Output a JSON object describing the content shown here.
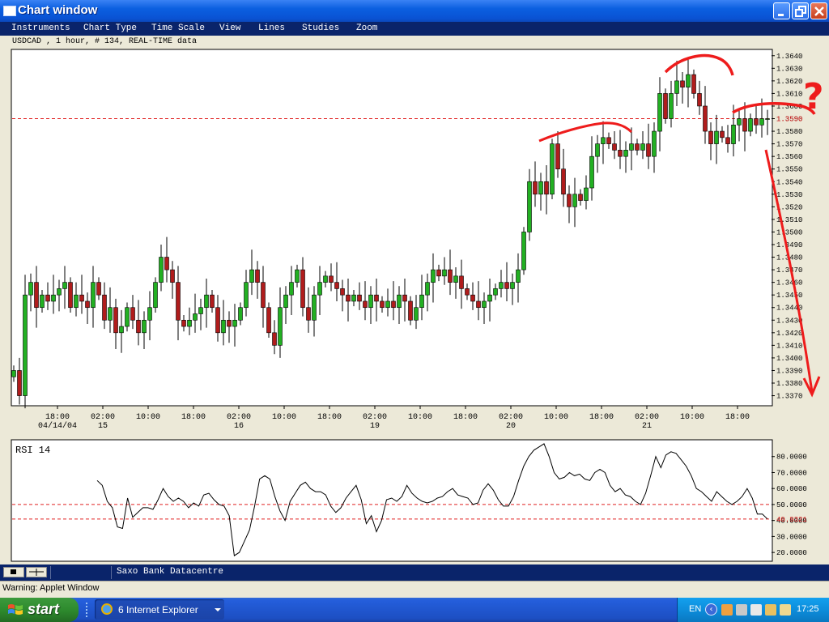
{
  "window": {
    "title": "Chart window",
    "buttons": [
      "minimize",
      "maximize",
      "close"
    ]
  },
  "menu": [
    "Instruments",
    "Chart Type",
    "Time Scale",
    "View",
    "Lines",
    "Studies",
    "Zoom"
  ],
  "info_line": "USDCAD , 1 hour, # 134, REAL-TIME data",
  "chart_data": [
    {
      "type": "candlestick",
      "title": "USDCAD , 1 hour, # 134, REAL-TIME data",
      "y_range": [
        1.3362,
        1.3645
      ],
      "y_ticks": [
        "1.3640",
        "1.3630",
        "1.3620",
        "1.3610",
        "1.3600",
        "1.3590",
        "1.3580",
        "1.3570",
        "1.3560",
        "1.3550",
        "1.3540",
        "1.3530",
        "1.3520",
        "1.3510",
        "1.3500",
        "1.3490",
        "1.3480",
        "1.3470",
        "1.3460",
        "1.3450",
        "1.3440",
        "1.3430",
        "1.3420",
        "1.3410",
        "1.3400",
        "1.3390",
        "1.3380",
        "1.3370"
      ],
      "current_level": {
        "value": 1.359,
        "label": "1.3590",
        "color": "#e02020"
      },
      "x_labels": [
        {
          "t": "18:00",
          "d": "04/14/04"
        },
        {
          "t": "02:00",
          "d": "15"
        },
        {
          "t": "10:00",
          "d": ""
        },
        {
          "t": "18:00",
          "d": ""
        },
        {
          "t": "02:00",
          "d": "16"
        },
        {
          "t": "10:00",
          "d": ""
        },
        {
          "t": "18:00",
          "d": ""
        },
        {
          "t": "02:00",
          "d": "19"
        },
        {
          "t": "10:00",
          "d": ""
        },
        {
          "t": "18:00",
          "d": ""
        },
        {
          "t": "02:00",
          "d": "20"
        },
        {
          "t": "10:00",
          "d": ""
        },
        {
          "t": "18:00",
          "d": ""
        },
        {
          "t": "02:00",
          "d": "21"
        },
        {
          "t": "10:00",
          "d": ""
        },
        {
          "t": "18:00",
          "d": ""
        }
      ],
      "up_color": "#22b022",
      "down_color": "#b01c1c",
      "closes": [
        1.339,
        1.337,
        1.345,
        1.346,
        1.344,
        1.345,
        1.3445,
        1.345,
        1.3455,
        1.346,
        1.344,
        1.345,
        1.3445,
        1.344,
        1.346,
        1.345,
        1.343,
        1.344,
        1.342,
        1.3425,
        1.344,
        1.343,
        1.342,
        1.343,
        1.344,
        1.346,
        1.348,
        1.347,
        1.346,
        1.343,
        1.3425,
        1.343,
        1.3435,
        1.344,
        1.345,
        1.344,
        1.342,
        1.343,
        1.3425,
        1.343,
        1.344,
        1.346,
        1.347,
        1.346,
        1.344,
        1.342,
        1.341,
        1.344,
        1.345,
        1.346,
        1.347,
        1.344,
        1.343,
        1.345,
        1.346,
        1.3465,
        1.346,
        1.3455,
        1.345,
        1.3445,
        1.345,
        1.3445,
        1.344,
        1.345,
        1.3445,
        1.344,
        1.3445,
        1.344,
        1.345,
        1.3445,
        1.343,
        1.344,
        1.345,
        1.346,
        1.347,
        1.3465,
        1.347,
        1.346,
        1.3465,
        1.3455,
        1.345,
        1.3445,
        1.344,
        1.3445,
        1.345,
        1.3455,
        1.346,
        1.3455,
        1.346,
        1.347,
        1.35,
        1.354,
        1.353,
        1.354,
        1.353,
        1.357,
        1.355,
        1.353,
        1.352,
        1.353,
        1.3525,
        1.3535,
        1.356,
        1.357,
        1.3575,
        1.357,
        1.3565,
        1.356,
        1.3565,
        1.357,
        1.3565,
        1.357,
        1.356,
        1.358,
        1.361,
        1.359,
        1.361,
        1.362,
        1.3615,
        1.3625,
        1.361,
        1.36,
        1.358,
        1.357,
        1.358,
        1.3575,
        1.357,
        1.3585,
        1.359,
        1.358,
        1.359,
        1.3585,
        1.359,
        1.359
      ]
    },
    {
      "type": "line",
      "title": "RSI 14",
      "y_range": [
        15,
        90
      ],
      "y_ticks": [
        "80.0000",
        "70.0000",
        "60.0000",
        "50.0000",
        "40.0000",
        "30.0000",
        "20.0000"
      ],
      "reference_levels": [
        50,
        40.9321
      ],
      "current_value": {
        "value": 40.9321,
        "label": "40.9321",
        "color": "#e02020"
      },
      "values": [
        65,
        62,
        52,
        48,
        36,
        35,
        54,
        42,
        45,
        48,
        48,
        47,
        53,
        60,
        55,
        52,
        54,
        52,
        48,
        51,
        49,
        56,
        57,
        53,
        50,
        49,
        43,
        18,
        20,
        27,
        34,
        49,
        66,
        68,
        66,
        55,
        46,
        40,
        52,
        57,
        62,
        64,
        60,
        58,
        58,
        56,
        49,
        45,
        48,
        54,
        58,
        62,
        53,
        38,
        43,
        33,
        40,
        53,
        54,
        52,
        55,
        62,
        57,
        54,
        52,
        51,
        52,
        54,
        55,
        58,
        60,
        56,
        55,
        54,
        50,
        51,
        59,
        63,
        59,
        53,
        49,
        49,
        55,
        65,
        74,
        80,
        84,
        86,
        88,
        80,
        70,
        66,
        67,
        70,
        68,
        69,
        66,
        65,
        70,
        72,
        70,
        62,
        58,
        60,
        56,
        55,
        52,
        50,
        57,
        68,
        80,
        73,
        81,
        83,
        82,
        78,
        74,
        68,
        60,
        58,
        55,
        52,
        58,
        55,
        52,
        50,
        52,
        55,
        60,
        54,
        44,
        44,
        40.9321
      ]
    }
  ],
  "annotations": {
    "question_mark": "?"
  },
  "statusbar": {
    "text": "Saxo Bank Datacentre"
  },
  "warning": "Warning: Applet Window",
  "taskbar": {
    "start_label": "start",
    "task_count": "6",
    "task_label": "Internet Explorer",
    "language": "EN",
    "clock": "17:25"
  }
}
